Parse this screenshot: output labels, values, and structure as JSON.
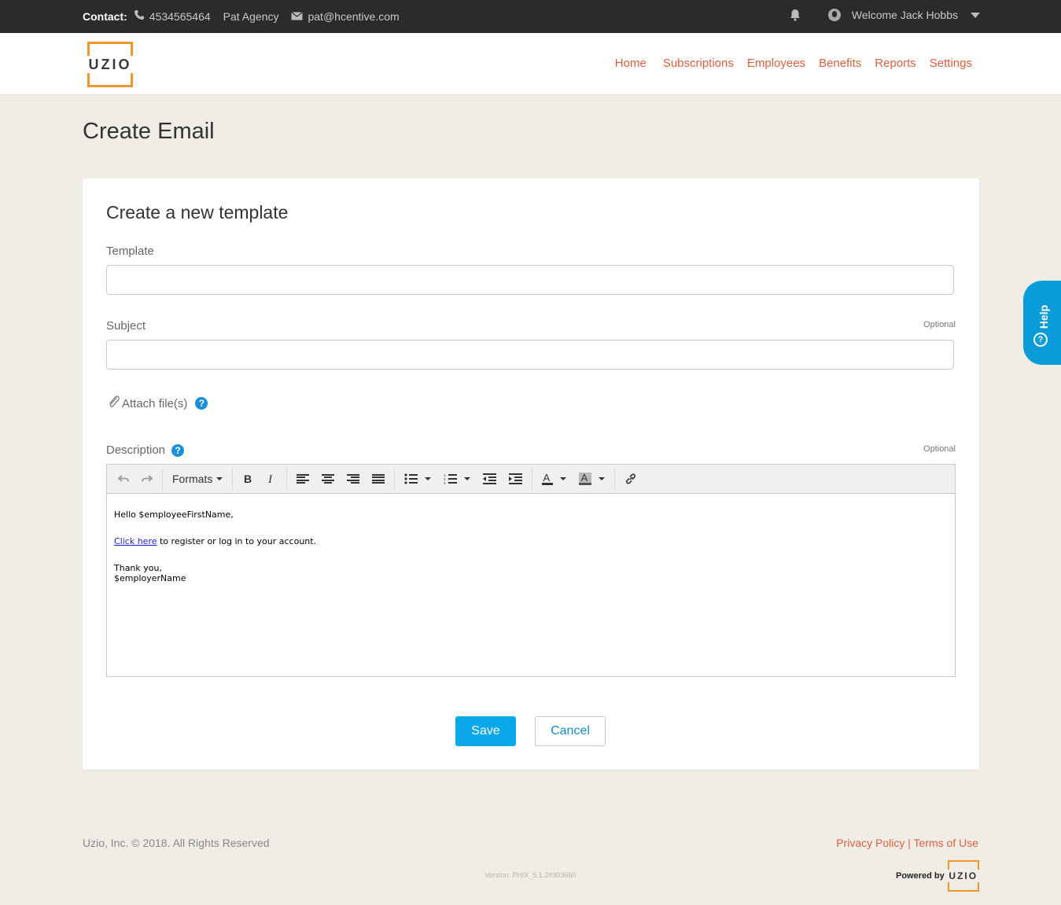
{
  "topbar": {
    "contact_label": "Contact:",
    "phone": "4534565464",
    "agency": "Pat Agency",
    "email": "pat@hcentive.com",
    "welcome": "Welcome Jack Hobbs"
  },
  "header": {
    "logo_text": "UZIO",
    "nav": [
      "Home",
      "Subscriptions",
      "Employees",
      "Benefits",
      "Reports",
      "Settings"
    ]
  },
  "page": {
    "title": "Create Email"
  },
  "form": {
    "card_title": "Create a new template",
    "template_label": "Template",
    "template_value": "",
    "subject_label": "Subject",
    "subject_optional": "Optional",
    "subject_value": "",
    "attach_label": "Attach file(s)",
    "description_label": "Description",
    "description_optional": "Optional",
    "help_glyph": "?",
    "save_label": "Save",
    "cancel_label": "Cancel"
  },
  "editor": {
    "formats_label": "Formats",
    "line1": "Hello $employeeFirstName,",
    "link_text": "Click here",
    "line2_rest": " to register or log in to your account.",
    "line3": "Thank you,",
    "line4": "$employerName"
  },
  "help_tab": {
    "label": "Help",
    "glyph": "?"
  },
  "footer": {
    "copyright": "Uzio, Inc. © 2018. All Rights Reserved",
    "privacy": "Privacy Policy",
    "separator": " | ",
    "terms": "Terms of Use",
    "version": "Version: PHIX_5.1.2#303660",
    "powered_by": "Powered by",
    "logo_text": "UZIO"
  },
  "colors": {
    "accent_orange": "#d9603f",
    "logo_orange": "#f0962a",
    "primary_blue": "#0aa7ea",
    "topbar_bg": "#2b2b2d",
    "page_bg": "#f0ede7"
  }
}
